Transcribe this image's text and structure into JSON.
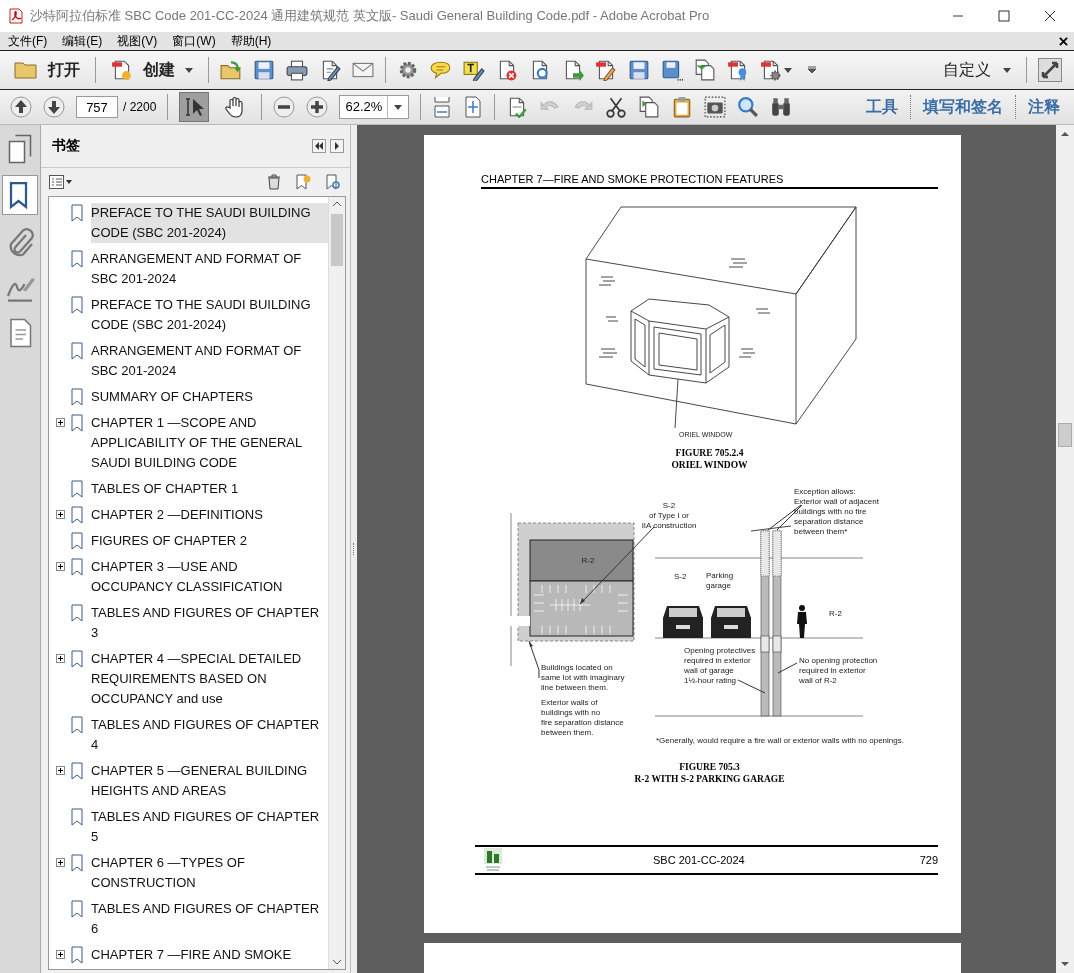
{
  "window": {
    "title": "沙特阿拉伯标准 SBC Code 201-CC-2024 通用建筑规范 英文版- Saudi General Building Code.pdf - Adobe Acrobat Pro"
  },
  "menu": [
    "文件(F)",
    "编辑(E)",
    "视图(V)",
    "窗口(W)",
    "帮助(H)"
  ],
  "toolbar": {
    "open": "打开",
    "create": "创建",
    "customize": "自定义"
  },
  "nav": {
    "page": "757",
    "page_count": "/ 2200",
    "zoom": "62.2%",
    "tools": [
      {
        "selected": true
      },
      {
        "selected": false
      }
    ],
    "history": [
      {
        "disabled": true
      },
      {
        "disabled": true
      }
    ],
    "panes": [
      "工具",
      "填写和签名",
      "注释"
    ]
  },
  "side_tabs": [
    {
      "selected": false
    },
    {
      "selected": true
    },
    {
      "selected": false
    },
    {
      "selected": false
    },
    {
      "selected": false
    }
  ],
  "bookmarks": {
    "title": "书签",
    "items": [
      {
        "label": "PREFACE TO THE SAUDI BUILDING CODE (SBC 201-2024)",
        "kind": "leaf",
        "selected": true
      },
      {
        "label": "ARRANGEMENT AND FORMAT OF SBC 201-2024",
        "kind": "leaf",
        "selected": false
      },
      {
        "label": "PREFACE TO THE SAUDI BUILDING CODE (SBC 201-2024)",
        "kind": "leaf",
        "selected": false
      },
      {
        "label": "ARRANGEMENT AND FORMAT OF SBC 201-2024",
        "kind": "leaf",
        "selected": false
      },
      {
        "label": "SUMMARY OF CHAPTERS",
        "kind": "leaf",
        "selected": false
      },
      {
        "label": "CHAPTER 1 —SCOPE AND APPLICABILITY OF THE GENERAL SAUDI BUILDING CODE",
        "kind": "group",
        "expanded": false,
        "selected": false
      },
      {
        "label": "TABLES OF CHAPTER 1",
        "kind": "leaf",
        "selected": false
      },
      {
        "label": "CHAPTER 2 —DEFINITIONS",
        "kind": "group",
        "expanded": false,
        "selected": false
      },
      {
        "label": "FIGURES OF CHAPTER 2",
        "kind": "leaf",
        "selected": false
      },
      {
        "label": "CHAPTER 3 —USE AND OCCUPANCY CLASSIFICATION",
        "kind": "group",
        "expanded": false,
        "selected": false
      },
      {
        "label": "TABLES AND FIGURES OF CHAPTER 3",
        "kind": "leaf",
        "selected": false
      },
      {
        "label": "CHAPTER 4 —SPECIAL DETAILED REQUIREMENTS BASED ON OCCUPANCY and use",
        "kind": "group",
        "expanded": false,
        "selected": false
      },
      {
        "label": "TABLES AND FIGURES OF CHAPTER 4",
        "kind": "leaf",
        "selected": false
      },
      {
        "label": "CHAPTER 5 —GENERAL BUILDING HEIGHTS AND AREAS",
        "kind": "group",
        "expanded": false,
        "selected": false
      },
      {
        "label": "TABLES AND FIGURES OF CHAPTER 5",
        "kind": "leaf",
        "selected": false
      },
      {
        "label": "CHAPTER 6 —TYPES OF CONSTRUCTION",
        "kind": "group",
        "expanded": false,
        "selected": false
      },
      {
        "label": "TABLES AND FIGURES OF CHAPTER 6",
        "kind": "leaf",
        "selected": false
      },
      {
        "label": "CHAPTER 7 —FIRE AND SMOKE",
        "kind": "group",
        "expanded": false,
        "selected": false
      }
    ]
  },
  "page": {
    "header": "CHAPTER 7—FIRE AND SMOKE PROTECTION FEATURES",
    "figure_1": {
      "callout": "ORIEL WINDOW",
      "number": "FIGURE 705.2.4",
      "caption": "ORIEL WINDOW"
    },
    "figure_2": {
      "labels": [
        [
          "S-2",
          "of Type I or",
          "IIA construction"
        ],
        [
          "R-2"
        ],
        [
          "Exception allows:",
          "Exterior wall of adjacent",
          "buildings with no fire",
          "separation distance",
          "between them*"
        ],
        [
          "S-2"
        ],
        [
          "Parking",
          "garage"
        ],
        [
          "R-2"
        ],
        [
          "Opening protectives",
          "required in exterior",
          "wall of garage",
          "1½-hour rating"
        ],
        [
          "No opening protection",
          "required in exterior",
          "wall of R-2"
        ],
        [
          "Buildings located on",
          "same lot with imaginary",
          "line between them."
        ],
        [
          "Exterior walls of",
          "buildings with no",
          "fire separation distance",
          "between them."
        ],
        [
          "*Generally, would require a fire wall or exterior walls with no openings."
        ]
      ],
      "number": "FIGURE 705.3",
      "caption": "R-2 WITH S-2 PARKING GARAGE"
    },
    "footer": {
      "code": "SBC 201-CC-2024",
      "page_number": "729"
    }
  }
}
